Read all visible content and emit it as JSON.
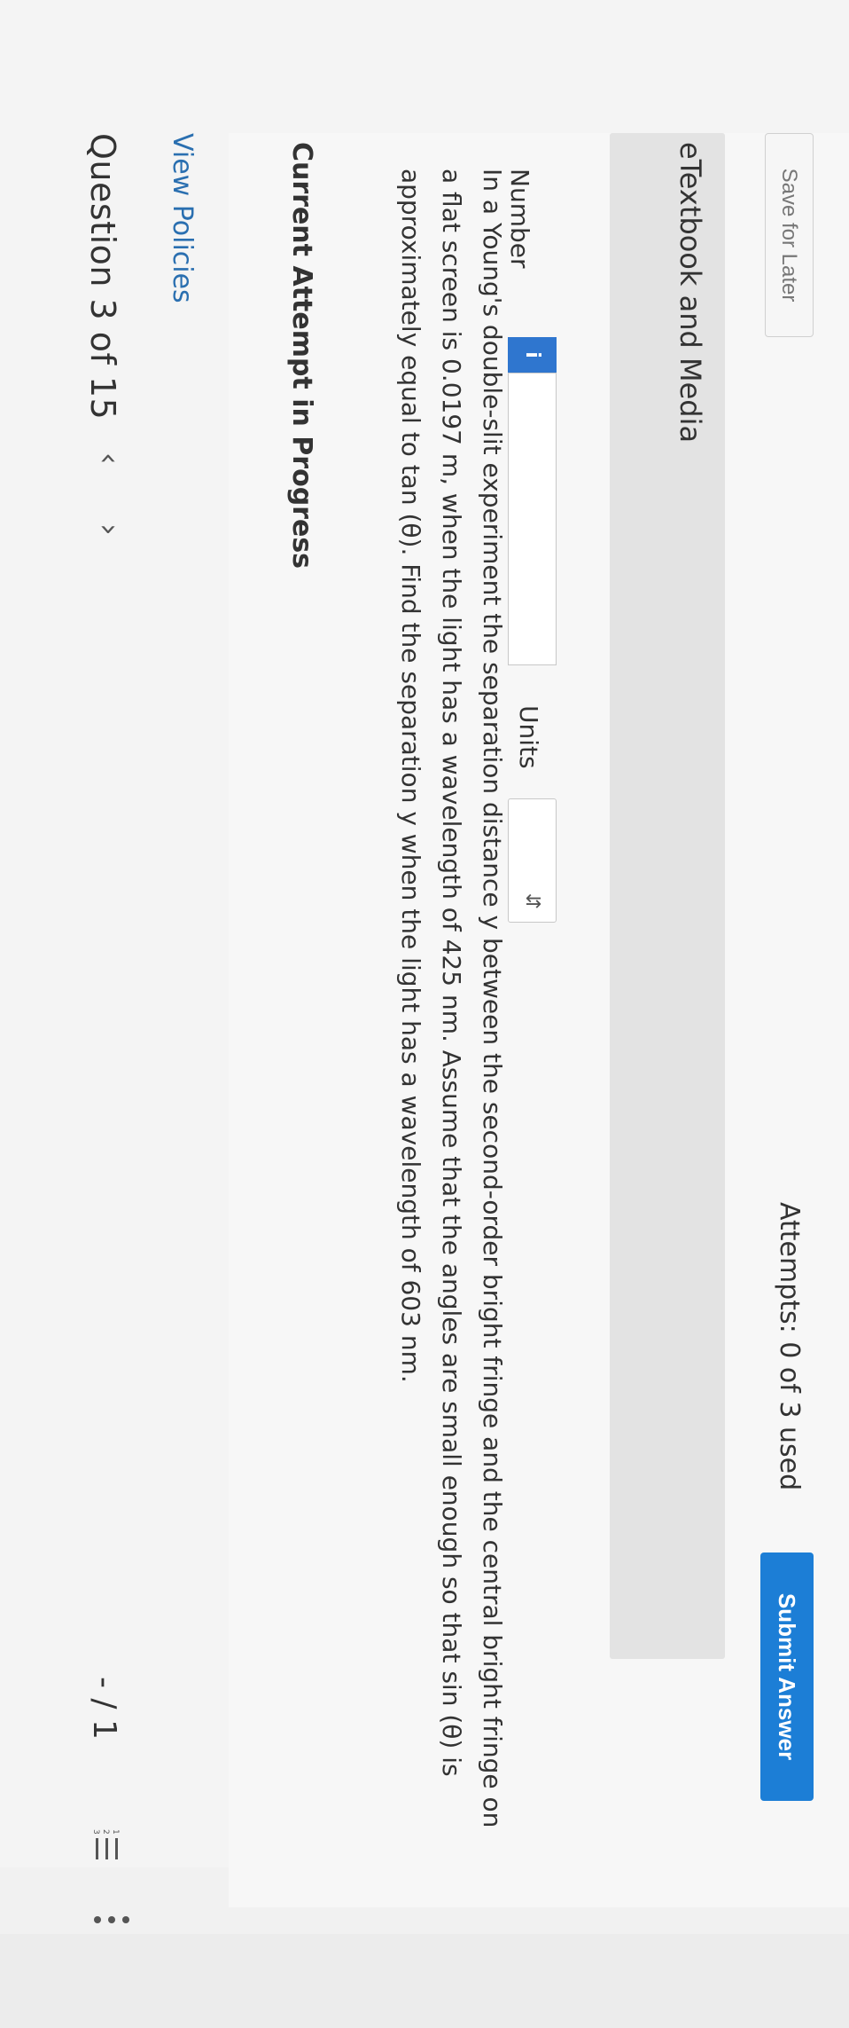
{
  "header": {
    "question_label": "Question 3 of 15",
    "prev_icon": "‹",
    "next_icon": "›",
    "score": "- / 1",
    "list_icon_name": "numbered-list-icon",
    "more_icon_name": "more-vertical-icon"
  },
  "links": {
    "view_policies": "View Policies"
  },
  "attempt": {
    "section_title": "Current Attempt in Progress",
    "question_text": "In a Young's double-slit experiment the separation distance y between the second-order bright fringe and the central bright fringe on a flat screen is 0.0197 m, when the light has a wavelength of 425 nm. Assume that the angles are small enough so that sin (θ) is approximately equal to tan (θ). Find the separation y when the light has a wavelength of 603 nm.",
    "number_label": "Number",
    "info_badge": "i",
    "number_value": "",
    "units_label": "Units",
    "units_value": ""
  },
  "etextbook": {
    "label": "eTextbook and Media"
  },
  "footer": {
    "save_label": "Save for Later",
    "attempts_text": "Attempts: 0 of 3 used",
    "submit_label": "Submit Answer"
  },
  "colors": {
    "accent": "#1c7ed6",
    "link": "#2a6fb0"
  }
}
